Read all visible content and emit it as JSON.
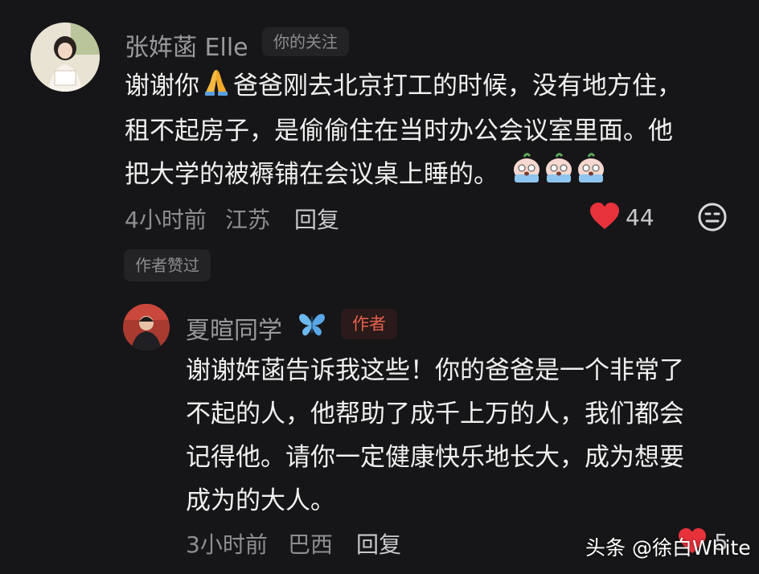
{
  "colors": {
    "background": "#161618",
    "heart": "#e8323b",
    "author_tag_text": "#e6604c",
    "butterfly": "#6db7ef"
  },
  "comment": {
    "username": "张姩菡 Elle",
    "follow_tag": "你的关注",
    "lines": [
      [
        "谢谢你",
        "爸爸刚去北京打工的时候，没有地方住，"
      ],
      "租不起房子，是偷偷住在当时办公会议室里面。他",
      "把大学的被褥铺在会议桌上睡的。"
    ],
    "praying_emoji_icon": "praying-hands-icon",
    "crying_emoji_icon": "crying-face-emoji-icon",
    "time": "4小时前",
    "location": "江苏",
    "reply_label": "回复",
    "like_count": "44",
    "liked_by_author": "作者赞过"
  },
  "reply": {
    "username": "夏暄同学",
    "butterfly_icon": "butterfly-icon",
    "author_tag": "作者",
    "lines": [
      "谢谢姩菡告诉我这些！你的爸爸是一个非常了",
      "不起的人，他帮助了成千上万的人，我们都会",
      "记得他。请你一定健康快乐地长大，成为想要",
      "成为的大人。"
    ],
    "time": "3小时前",
    "location": "巴西",
    "reply_label": "回复",
    "like_count": "5"
  },
  "watermark": "头条 @徐白White"
}
